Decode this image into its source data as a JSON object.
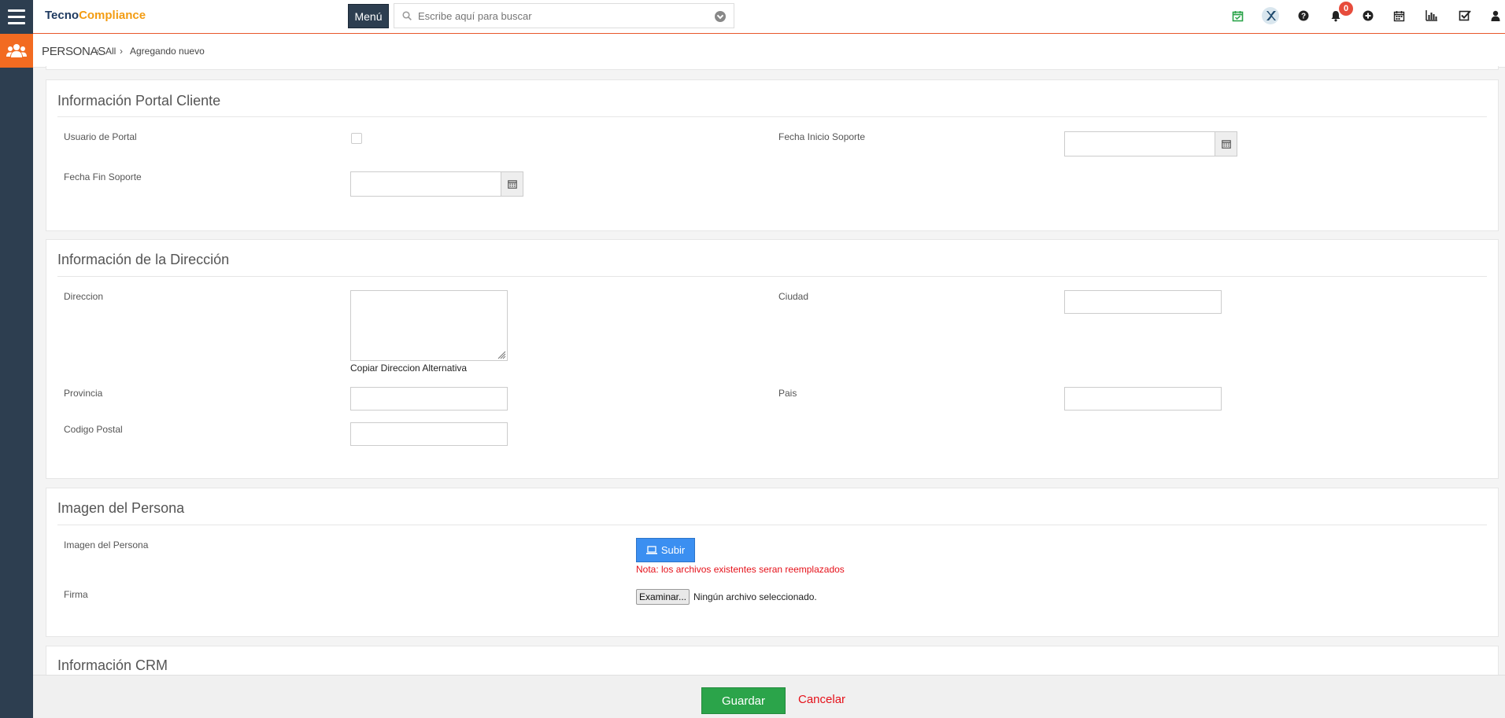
{
  "header": {
    "logo_part1": "Tecno",
    "logo_part2": "Compliance",
    "menu_label": "Menú",
    "search_placeholder": "Escribe aquí para buscar",
    "notification_count": "0",
    "colors": {
      "sidebar": "#2d3e50",
      "accent": "#f26b21",
      "logo_blue": "#1f3a60",
      "logo_orange": "#f39c12"
    },
    "icons": [
      "calendar-check-icon",
      "x-logo-icon",
      "help-icon",
      "bell-icon",
      "plus-circle-icon",
      "calendar-icon",
      "bar-chart-icon",
      "checkbox-icon",
      "user-icon"
    ]
  },
  "breadcrumb": {
    "module": "PERSONAS",
    "all": "All",
    "current": "Agregando nuevo"
  },
  "portal_panel": {
    "title": "Información Portal Cliente",
    "usuario_portal_label": "Usuario de Portal",
    "fecha_inicio_label": "Fecha Inicio Soporte",
    "fecha_fin_label": "Fecha Fin Soporte"
  },
  "address_panel": {
    "title": "Información de la Dirección",
    "direccion_label": "Direccion",
    "copy_link": "Copiar Direccion Alternativa",
    "ciudad_label": "Ciudad",
    "provincia_label": "Provincia",
    "pais_label": "Pais",
    "codigo_postal_label": "Codigo Postal"
  },
  "image_panel": {
    "title": "Imagen del Persona",
    "imagen_label": "Imagen del Persona",
    "upload_label": "Subir",
    "note": "Nota: los archivos existentes seran reemplazados",
    "firma_label": "Firma",
    "browse_label": "Examinar...",
    "no_file_text": "Ningún archivo seleccionado."
  },
  "crm_panel": {
    "title": "Información CRM"
  },
  "footer": {
    "save_label": "Guardar",
    "cancel_label": "Cancelar"
  }
}
